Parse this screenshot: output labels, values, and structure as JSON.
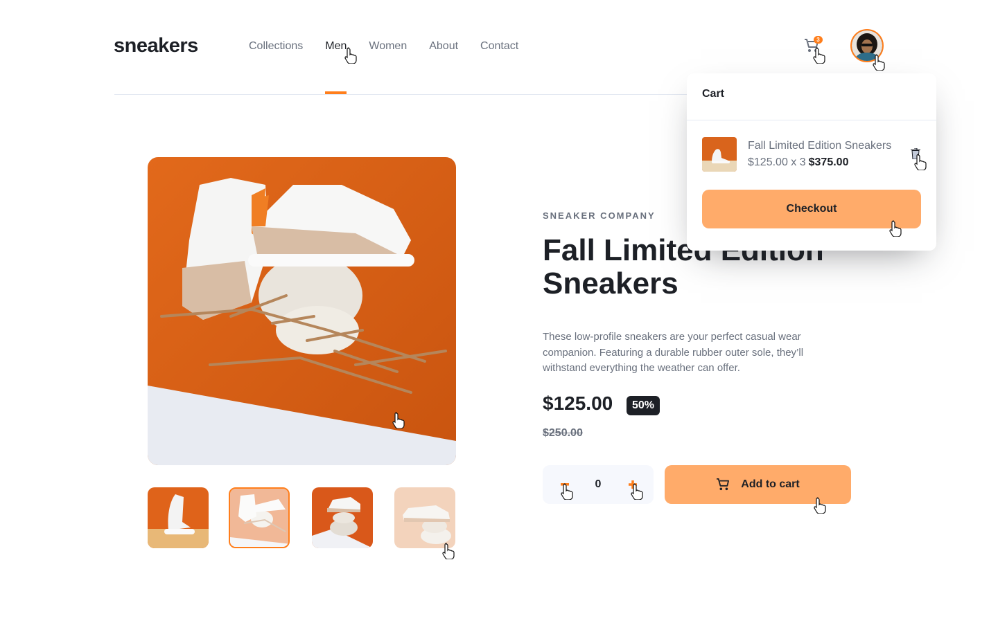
{
  "header": {
    "logo": "sneakers",
    "nav": [
      {
        "label": "Collections",
        "active": false
      },
      {
        "label": "Men",
        "active": true
      },
      {
        "label": "Women",
        "active": false
      },
      {
        "label": "About",
        "active": false
      },
      {
        "label": "Contact",
        "active": false
      }
    ],
    "cart_icon": "cart-icon",
    "cart_count": "3",
    "avatar_icon": "avatar"
  },
  "cart": {
    "title": "Cart",
    "item": {
      "name": "Fall Limited Edition Sneakers",
      "unit_price_qty": "$125.00 x 3",
      "total": "$375.00",
      "delete_icon": "trash-icon"
    },
    "checkout_label": "Checkout"
  },
  "gallery": {
    "main_image": "product-image-1",
    "thumbnails": [
      "thumbnail-1",
      "thumbnail-2",
      "thumbnail-3",
      "thumbnail-4"
    ],
    "active_thumbnail": 2
  },
  "product": {
    "company": "SNEAKER COMPANY",
    "title": "Fall Limited Edition Sneakers",
    "description": "These low-profile sneakers are your perfect casual wear companion. Featuring a durable rubber outer sole, they’ll withstand everything the weather can offer.",
    "price": "$125.00",
    "discount": "50%",
    "original_price": "$250.00",
    "quantity": "0",
    "minus_icon": "minus-icon",
    "plus_icon": "plus-icon",
    "add_to_cart_label": "Add to cart",
    "add_to_cart_icon": "cart-icon"
  },
  "colors": {
    "accent": "#ff7e1b",
    "accent_pale": "#ffab6a",
    "dark": "#1d2026",
    "muted": "#69707d"
  }
}
